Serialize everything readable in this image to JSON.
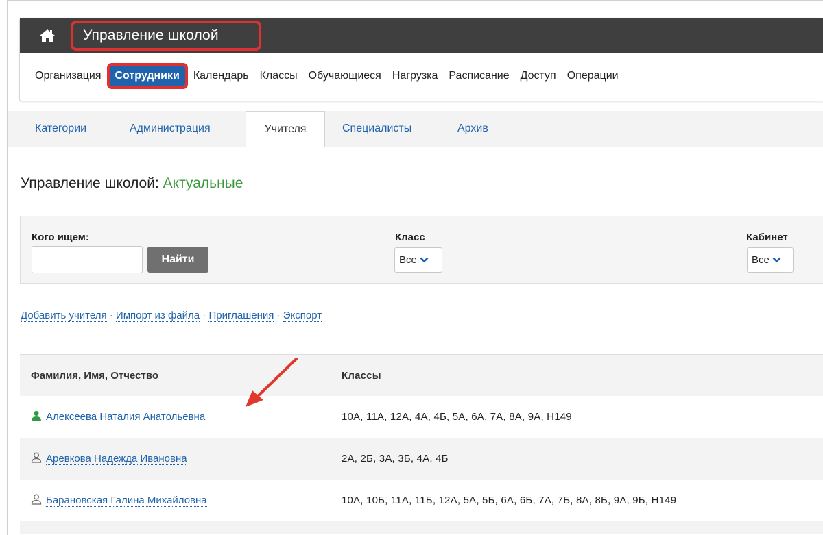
{
  "app": {
    "title": "Управление школой"
  },
  "nav": {
    "items": [
      {
        "label": "Организация",
        "active": false
      },
      {
        "label": "Сотрудники",
        "active": true
      },
      {
        "label": "Календарь",
        "active": false
      },
      {
        "label": "Классы",
        "active": false
      },
      {
        "label": "Обучающиеся",
        "active": false
      },
      {
        "label": "Нагрузка",
        "active": false
      },
      {
        "label": "Расписание",
        "active": false
      },
      {
        "label": "Доступ",
        "active": false
      },
      {
        "label": "Операции",
        "active": false
      }
    ]
  },
  "tabs": [
    {
      "label": "Категории",
      "active": false
    },
    {
      "label": "Администрация",
      "active": false
    },
    {
      "label": "Учителя",
      "active": true
    },
    {
      "label": "Специалисты",
      "active": false
    },
    {
      "label": "Архив",
      "active": false
    }
  ],
  "heading": {
    "prefix": "Управление школой:",
    "status": "Актуальные"
  },
  "filter": {
    "search_label": "Кого ищем:",
    "search_value": "",
    "search_button": "Найти",
    "class_label": "Класс",
    "class_value": "Все",
    "room_label": "Кабинет",
    "room_value": "Все"
  },
  "actions": {
    "add_teacher": "Добавить учителя",
    "import": "Импорт из файла",
    "invitations": "Приглашения",
    "export": "Экспорт",
    "separator": "·"
  },
  "table": {
    "headers": [
      "Фамилия, Имя, Отчество",
      "Классы"
    ],
    "rows": [
      {
        "name": "Алексеева Наталия Анатольевна",
        "classes": "10А, 11А, 12А, 4А, 4Б, 5А, 6А, 7А, 8А, 9А, Н149",
        "icon": "user-filled-icon"
      },
      {
        "name": "Аревкова Надежда Ивановна",
        "classes": "2А, 2Б, 3А, 3Б, 4А, 4Б",
        "icon": "user-outline-icon"
      },
      {
        "name": "Барановская Галина Михайловна",
        "classes": "10А, 10Б, 11А, 11Б, 12А, 5А, 5Б, 6А, 6Б, 7А, 7Б, 8А, 8Б, 9А, 9Б, Н149",
        "icon": "user-outline-icon"
      }
    ]
  },
  "colors": {
    "accent": "#1f63ad",
    "highlight": "#e03030",
    "status_green": "#3a9a3a",
    "dark_bar": "#3f3f3f"
  }
}
